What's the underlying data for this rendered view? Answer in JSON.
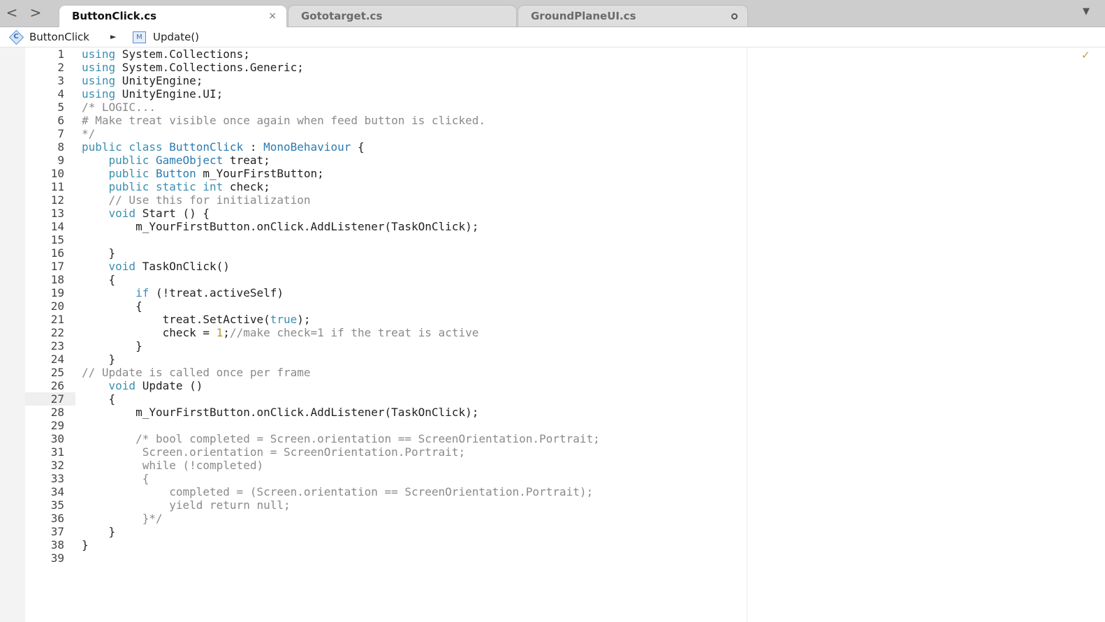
{
  "tabs": [
    {
      "label": "ButtonClick.cs",
      "active": true,
      "control": "×"
    },
    {
      "label": "Gototarget.cs",
      "active": false,
      "control": ""
    },
    {
      "label": "GroundPlaneUI.cs",
      "active": false,
      "control": "modified-dot"
    }
  ],
  "nav": {
    "back": "<",
    "forward": ">",
    "tabs_menu": "▼"
  },
  "breadcrumb": {
    "class_icon_letter": "C",
    "class_name": "ButtonClick",
    "separator": "►",
    "method_icon_letter": "M",
    "method_name": "Update()"
  },
  "editor": {
    "current_line": 27,
    "status_mark": "✓",
    "colors": {
      "keyword": "#3a8fb0",
      "type": "#2b7bb0",
      "comment": "#8a8a8a",
      "number": "#b59a2c"
    },
    "lines": [
      [
        [
          "kw",
          "using"
        ],
        [
          "pl",
          " System.Collections;"
        ]
      ],
      [
        [
          "kw",
          "using"
        ],
        [
          "pl",
          " System.Collections.Generic;"
        ]
      ],
      [
        [
          "kw",
          "using"
        ],
        [
          "pl",
          " UnityEngine;"
        ]
      ],
      [
        [
          "kw",
          "using"
        ],
        [
          "pl",
          " UnityEngine.UI;"
        ]
      ],
      [
        [
          "cm",
          "/* LOGIC..."
        ]
      ],
      [
        [
          "cm",
          "# Make treat visible once again when feed button is clicked."
        ]
      ],
      [
        [
          "cm",
          "*/"
        ]
      ],
      [
        [
          "kw",
          "public class "
        ],
        [
          "ty",
          "ButtonClick"
        ],
        [
          "pl",
          " : "
        ],
        [
          "ty",
          "MonoBehaviour"
        ],
        [
          "pl",
          " {"
        ]
      ],
      [
        [
          "pl",
          "    "
        ],
        [
          "kw",
          "public "
        ],
        [
          "ty",
          "GameObject"
        ],
        [
          "pl",
          " treat;"
        ]
      ],
      [
        [
          "pl",
          "    "
        ],
        [
          "kw",
          "public "
        ],
        [
          "ty",
          "Button"
        ],
        [
          "pl",
          " m_YourFirstButton;"
        ]
      ],
      [
        [
          "pl",
          "    "
        ],
        [
          "kw",
          "public static int"
        ],
        [
          "pl",
          " check;"
        ]
      ],
      [
        [
          "pl",
          "    "
        ],
        [
          "cm",
          "// Use this for initialization"
        ]
      ],
      [
        [
          "pl",
          "    "
        ],
        [
          "kw",
          "void"
        ],
        [
          "pl",
          " Start () {"
        ]
      ],
      [
        [
          "pl",
          "        m_YourFirstButton.onClick.AddListener(TaskOnClick);"
        ]
      ],
      [
        [
          "pl",
          ""
        ]
      ],
      [
        [
          "pl",
          "    }"
        ]
      ],
      [
        [
          "pl",
          "    "
        ],
        [
          "kw",
          "void"
        ],
        [
          "pl",
          " TaskOnClick()"
        ]
      ],
      [
        [
          "pl",
          "    {"
        ]
      ],
      [
        [
          "pl",
          "        "
        ],
        [
          "kw",
          "if"
        ],
        [
          "pl",
          " (!treat.activeSelf)"
        ]
      ],
      [
        [
          "pl",
          "        {"
        ]
      ],
      [
        [
          "pl",
          "            treat.SetActive("
        ],
        [
          "kw",
          "true"
        ],
        [
          "pl",
          ");"
        ]
      ],
      [
        [
          "pl",
          "            check = "
        ],
        [
          "num",
          "1"
        ],
        [
          "pl",
          ";"
        ],
        [
          "cm",
          "//make check=1 if the treat is active"
        ]
      ],
      [
        [
          "pl",
          "        }"
        ]
      ],
      [
        [
          "pl",
          "    }"
        ]
      ],
      [
        [
          "cm",
          "// Update is called once per frame"
        ]
      ],
      [
        [
          "pl",
          "    "
        ],
        [
          "kw",
          "void"
        ],
        [
          "pl",
          " Update ()"
        ]
      ],
      [
        [
          "pl",
          "    {"
        ]
      ],
      [
        [
          "pl",
          "        m_YourFirstButton.onClick.AddListener(TaskOnClick);"
        ]
      ],
      [
        [
          "pl",
          ""
        ]
      ],
      [
        [
          "pl",
          "        "
        ],
        [
          "cm",
          "/* bool completed = Screen.orientation == ScreenOrientation.Portrait;"
        ]
      ],
      [
        [
          "cm",
          "         Screen.orientation = ScreenOrientation.Portrait;"
        ]
      ],
      [
        [
          "cm",
          "         while (!completed)"
        ]
      ],
      [
        [
          "cm",
          "         {"
        ]
      ],
      [
        [
          "cm",
          "             completed = (Screen.orientation == ScreenOrientation.Portrait);"
        ]
      ],
      [
        [
          "cm",
          "             yield return null;"
        ]
      ],
      [
        [
          "cm",
          "         }*/"
        ]
      ],
      [
        [
          "pl",
          "    }"
        ]
      ],
      [
        [
          "pl",
          "}"
        ]
      ],
      [
        [
          "pl",
          ""
        ]
      ]
    ]
  }
}
